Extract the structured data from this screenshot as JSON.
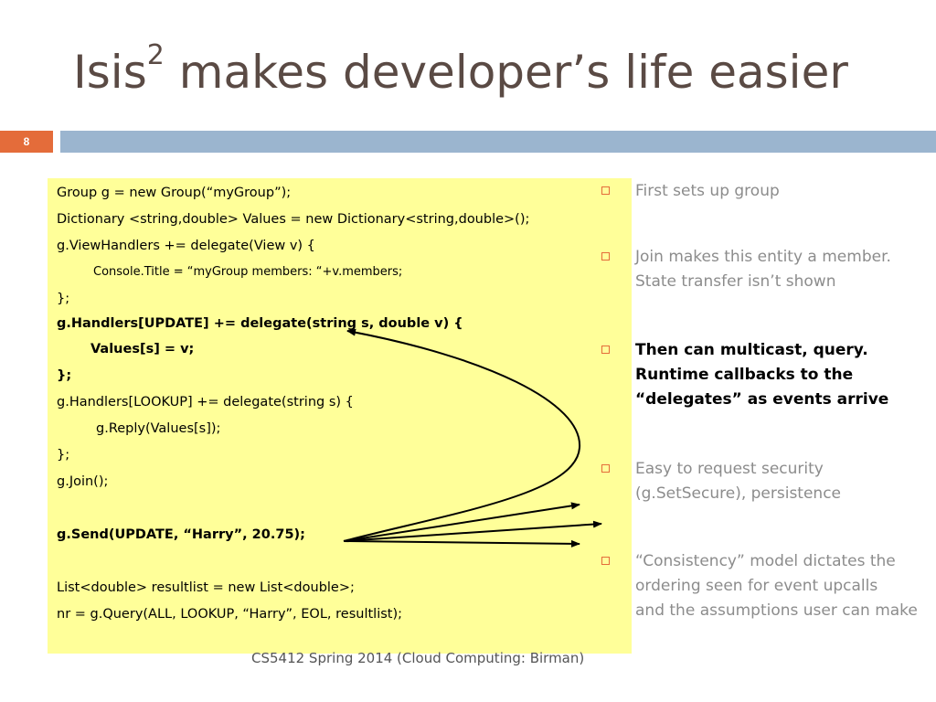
{
  "slide": {
    "title_main": "Isis",
    "title_sup": "2",
    "title_rest": " makes developer’s life easier",
    "number": "8",
    "footer": "CS5412 Spring 2014 (Cloud Computing: Birman)"
  },
  "colors": {
    "accent": "#e46c3a",
    "header_bar": "#9bb5cf",
    "code_background": "#ffff99",
    "title_text": "#5a4a44",
    "muted_text": "#8c8c8c"
  },
  "code": [
    {
      "text": "Group g = new Group(“myGroup”);",
      "bold": false
    },
    {
      "text": "Dictionary <string,double> Values = new Dictionary<string,double>();",
      "bold": false
    },
    {
      "text": "g.ViewHandlers += delegate(View v) {",
      "bold": false
    },
    {
      "text": "Console.Title = “myGroup members: “+v.members;",
      "bold": false
    },
    {
      "text": "};",
      "bold": false
    },
    {
      "text": "g.Handlers[UPDATE] += delegate(string s, double v) {",
      "bold": true
    },
    {
      "text": "Values[s] = v;",
      "bold": true
    },
    {
      "text": "};",
      "bold": true
    },
    {
      "text": "g.Handlers[LOOKUP] += delegate(string s) {",
      "bold": false
    },
    {
      "text": "g.Reply(Values[s]);",
      "bold": false
    },
    {
      "text": "};",
      "bold": false
    },
    {
      "text": "g.Join();",
      "bold": false
    },
    {
      "text": "g.Send(UPDATE, “Harry”, 20.75);",
      "bold": true
    },
    {
      "text": "List<double> resultlist = new List<double>;",
      "bold": false
    },
    {
      "text": "nr = g.Query(ALL, LOOKUP, “Harry”, EOL, resultlist);",
      "bold": false
    }
  ],
  "bullets": [
    {
      "lines": [
        "First sets up group"
      ],
      "emphasis": false
    },
    {
      "lines": [
        "Join makes this entity a member.",
        "State transfer isn’t shown"
      ],
      "emphasis": false
    },
    {
      "lines": [
        "Then can multicast, query.",
        "Runtime callbacks to the",
        "“delegates” as events arrive"
      ],
      "emphasis": true
    },
    {
      "lines": [
        "Easy to request security",
        "(g.SetSecure), persistence"
      ],
      "emphasis": false
    },
    {
      "lines": [
        "“Consistency” model dictates the",
        "ordering seen for event upcalls",
        "and the assumptions user can make"
      ],
      "emphasis": false
    }
  ]
}
